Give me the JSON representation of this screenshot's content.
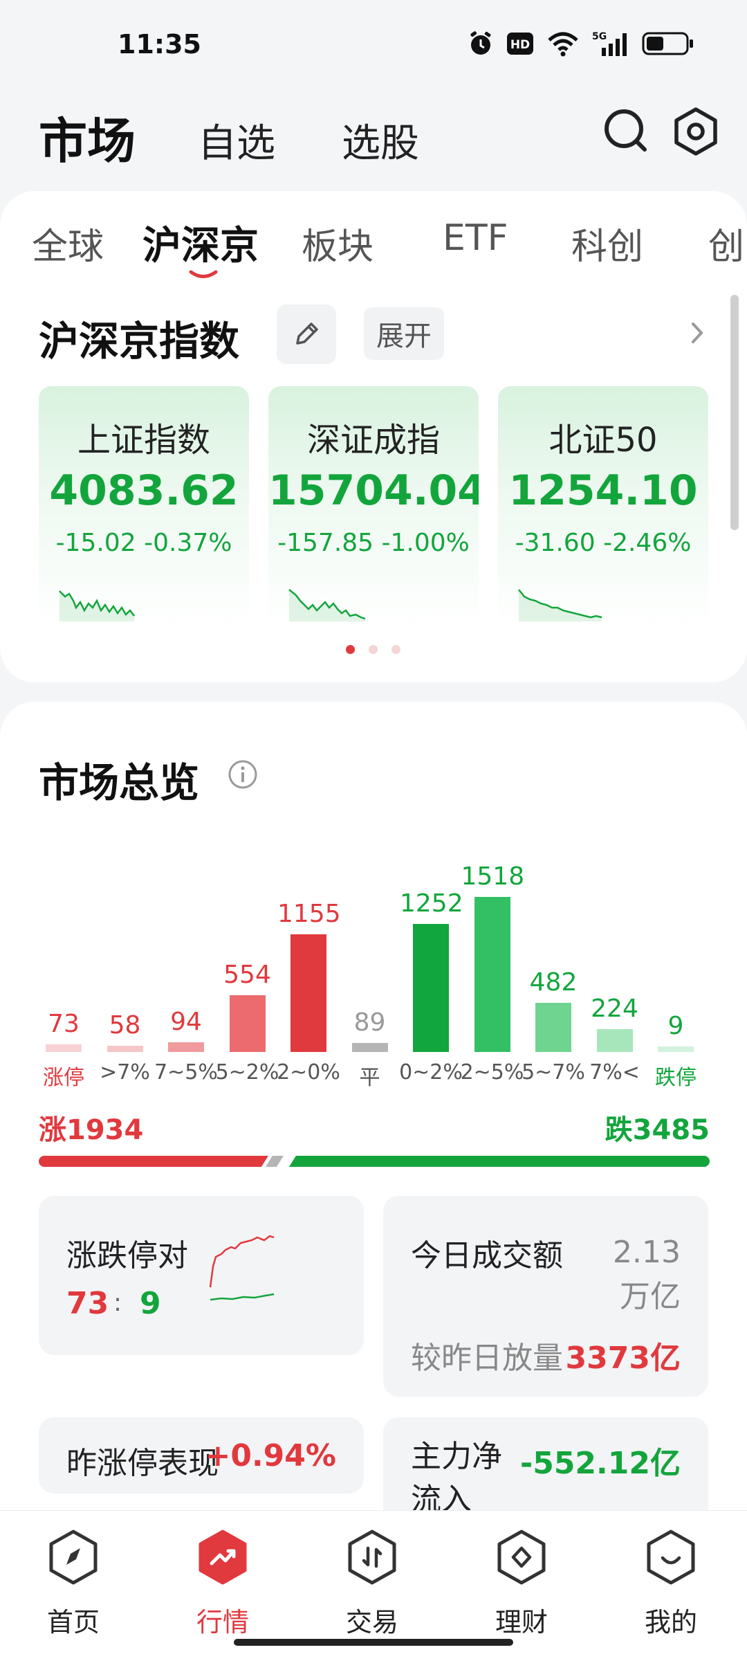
{
  "status": {
    "time": "11:35",
    "network": "5G"
  },
  "top_nav": {
    "title": "市场",
    "tabs": [
      "自选",
      "选股"
    ]
  },
  "index_card": {
    "tabs": [
      "全球",
      "沪深京",
      "板块",
      "ETF",
      "科创",
      "创"
    ],
    "active_tab": "沪深京",
    "section_title": "沪深京指数",
    "expand_label": "展开",
    "indices": [
      {
        "name": "上证指数",
        "value": "4083.62",
        "change": "-15.02",
        "pct": "-0.37%"
      },
      {
        "name": "深证成指",
        "value": "15704.04",
        "change": "-157.85",
        "pct": "-1.00%"
      },
      {
        "name": "北证50",
        "value": "1254.10",
        "change": "-31.60",
        "pct": "-2.46%"
      }
    ],
    "page_count": 3,
    "current_page": 1
  },
  "overview": {
    "title": "市场总览",
    "distribution": [
      {
        "label": "涨停",
        "count": 73,
        "color": "#f8d2d3"
      },
      {
        "label": ">7%",
        "count": 58,
        "color": "#f6c5c7"
      },
      {
        "label": "7~5%",
        "count": 94,
        "color": "#f09a9d"
      },
      {
        "label": "5~2%",
        "count": 554,
        "color": "#ec6b6e"
      },
      {
        "label": "2~0%",
        "count": 1155,
        "color": "#e0393e"
      },
      {
        "label": "平",
        "count": 89,
        "color": "#b5b5b5"
      },
      {
        "label": "0~2%",
        "count": 1252,
        "color": "#12a63e"
      },
      {
        "label": "2~5%",
        "count": 1518,
        "color": "#33bf63"
      },
      {
        "label": "5~7%",
        "count": 482,
        "color": "#6fd48f"
      },
      {
        "label": "7%<",
        "count": 224,
        "color": "#a7e6bb"
      },
      {
        "label": "跌停",
        "count": 9,
        "color": "#d3f2dd"
      }
    ],
    "up_label": "涨1934",
    "down_label": "跌3485",
    "up_count": 1934,
    "down_count": 3485,
    "limit_pair": {
      "title": "涨跌停对",
      "up": "73",
      "sep": ":",
      "down": "9"
    },
    "turnover": {
      "title": "今日成交额",
      "value": "2.13万亿",
      "vol_label": "较昨日放量",
      "vol_value": "3373亿"
    },
    "prev_limit": {
      "title": "昨涨停表现",
      "value": "+0.94%"
    },
    "main_flow": {
      "title": "主力净流入",
      "value": "-552.12亿"
    }
  },
  "bottom_nav": {
    "items": [
      "首页",
      "行情",
      "交易",
      "理财",
      "我的"
    ],
    "active": "行情"
  },
  "colors": {
    "up": "#e0393e",
    "down": "#13a53c",
    "flat": "#b5b5b5"
  }
}
